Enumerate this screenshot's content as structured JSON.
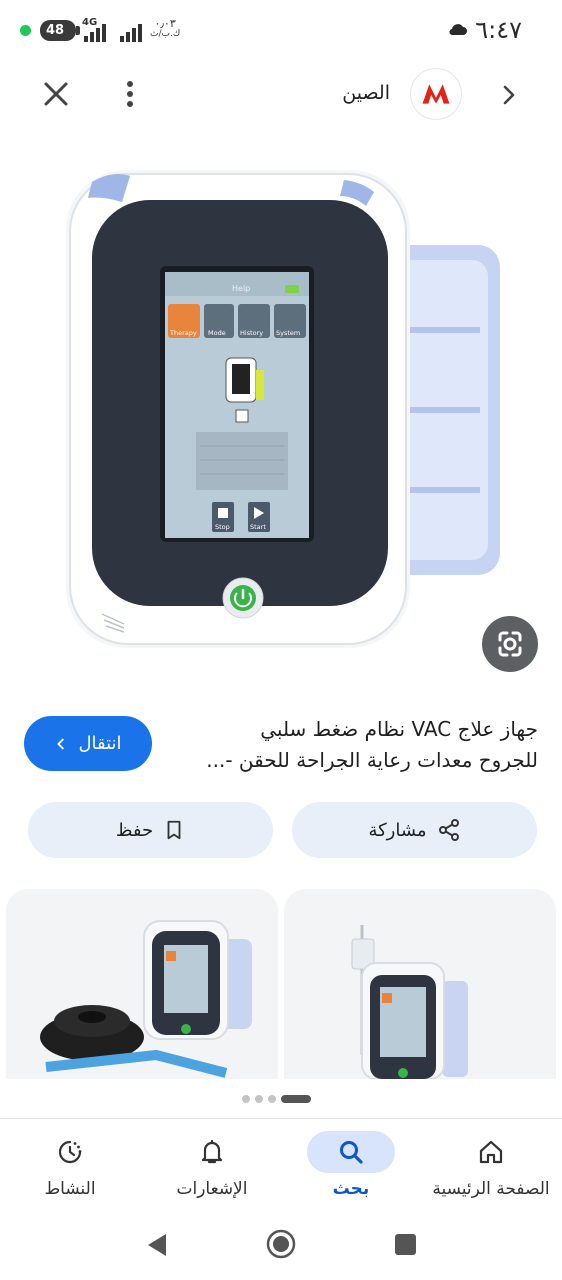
{
  "status_bar": {
    "time": "٦:٤٧",
    "battery": "48",
    "network": "4G",
    "data_rate": "٠٫٠٣",
    "data_unit": "ك.ب/ث"
  },
  "app_bar": {
    "source_name": "الصين",
    "logo_icon": "made-in-china-logo",
    "close_icon": "close-icon",
    "menu_icon": "more-vert-icon",
    "chevron_icon": "chevron-right-icon"
  },
  "product": {
    "title": "جهاز علاج VAC نظام ضغط سلبي للجروح معدات رعاية الجراحة للحقن -...",
    "visit_label": "انتقال",
    "share_label": "مشاركة",
    "save_label": "حفظ",
    "lens_icon": "google-lens-icon"
  },
  "device_screen": {
    "tabs": [
      "Therapy",
      "Mode",
      "History",
      "System"
    ],
    "stop_label": "Stop",
    "start_label": "Start",
    "help_label": "Help"
  },
  "bottom_nav": {
    "items": [
      {
        "label": "الصفحة الرئيسية",
        "icon": "home-icon"
      },
      {
        "label": "بحث",
        "icon": "search-icon"
      },
      {
        "label": "الإشعارات",
        "icon": "bell-icon"
      },
      {
        "label": "النشاط",
        "icon": "activity-icon"
      }
    ]
  },
  "colors": {
    "primary": "#1a73e8",
    "pill_bg": "#e8eff9",
    "nav_active_bg": "#d7e4fb",
    "nav_active_text": "#0b57d0"
  }
}
